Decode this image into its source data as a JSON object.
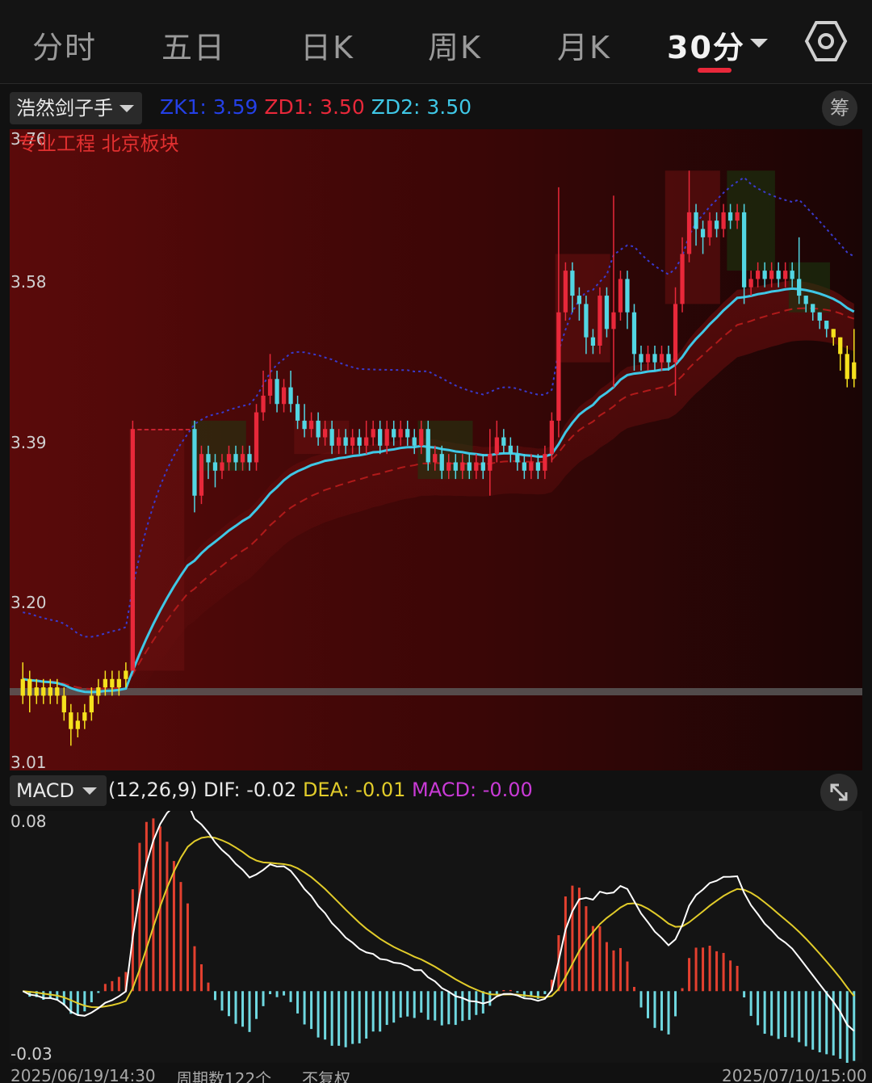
{
  "tabs": [
    {
      "label": "分时",
      "active": false
    },
    {
      "label": "五日",
      "active": false
    },
    {
      "label": "日K",
      "active": false
    },
    {
      "label": "周K",
      "active": false
    },
    {
      "label": "月K",
      "active": false
    },
    {
      "label": "30分",
      "active": true
    }
  ],
  "settings_icon": "hexagon-settings-icon",
  "indicator": {
    "name": "浩然剑子手",
    "zk1": "ZK1: 3.59",
    "zd1": "ZD1: 3.50",
    "zd2": "ZD2: 3.50",
    "chou_label": "筹"
  },
  "main_chart": {
    "price_labels": [
      "3.76",
      "3.58",
      "3.39",
      "3.20",
      "3.01"
    ],
    "sector_text": "专业工程 北京板块"
  },
  "macd": {
    "name": "MACD",
    "params": "(12,26,9)",
    "dif": "DIF: -0.02",
    "dea": "DEA: -0.01",
    "macd": "MACD: -0.00",
    "scale_top": "0.08",
    "scale_bottom": "-0.03"
  },
  "footer": {
    "start_time": "2025/06/19/14:30",
    "period_count": "周期数122个",
    "adjust": "不复权",
    "end_time": "2025/07/10/15:00"
  },
  "colors": {
    "up": "#e8283a",
    "down": "#52d6e3",
    "yellow": "#f5e11d",
    "zk1": "#2440e6",
    "zd1": "#e8283a",
    "zd2": "#3fc7e6",
    "dif": "#ffffff",
    "dea": "#e2cc2a",
    "macd": "#c93ad6",
    "hist_pos": "#e3402f",
    "hist_neg": "#6fd8e0"
  },
  "chart_data": {
    "type": "candlestick",
    "ylim": [
      3.01,
      3.76
    ],
    "candles": [
      [
        3.09,
        3.11,
        3.13,
        3.08
      ],
      [
        3.11,
        3.09,
        3.12,
        3.07
      ],
      [
        3.09,
        3.1,
        3.11,
        3.08
      ],
      [
        3.1,
        3.09,
        3.11,
        3.08
      ],
      [
        3.09,
        3.1,
        3.11,
        3.08
      ],
      [
        3.1,
        3.09,
        3.11,
        3.08
      ],
      [
        3.09,
        3.07,
        3.1,
        3.06
      ],
      [
        3.07,
        3.05,
        3.08,
        3.03
      ],
      [
        3.05,
        3.06,
        3.07,
        3.04
      ],
      [
        3.06,
        3.07,
        3.08,
        3.05
      ],
      [
        3.07,
        3.09,
        3.1,
        3.06
      ],
      [
        3.09,
        3.1,
        3.11,
        3.08
      ],
      [
        3.1,
        3.11,
        3.12,
        3.09
      ],
      [
        3.11,
        3.1,
        3.12,
        3.09
      ],
      [
        3.1,
        3.11,
        3.12,
        3.09
      ],
      [
        3.11,
        3.12,
        3.13,
        3.1
      ],
      [
        3.12,
        3.41,
        3.42,
        3.12
      ],
      [
        3.41,
        3.41,
        3.41,
        3.41
      ],
      [
        3.41,
        3.41,
        3.41,
        3.41
      ],
      [
        3.41,
        3.41,
        3.41,
        3.41
      ],
      [
        3.41,
        3.41,
        3.41,
        3.41
      ],
      [
        3.41,
        3.41,
        3.41,
        3.41
      ],
      [
        3.41,
        3.41,
        3.41,
        3.41
      ],
      [
        3.41,
        3.41,
        3.41,
        3.41
      ],
      [
        3.41,
        3.41,
        3.41,
        3.41
      ],
      [
        3.41,
        3.33,
        3.42,
        3.31
      ],
      [
        3.33,
        3.38,
        3.39,
        3.32
      ],
      [
        3.38,
        3.37,
        3.39,
        3.35
      ],
      [
        3.37,
        3.36,
        3.38,
        3.34
      ],
      [
        3.36,
        3.37,
        3.38,
        3.35
      ],
      [
        3.37,
        3.38,
        3.39,
        3.36
      ],
      [
        3.38,
        3.37,
        3.39,
        3.36
      ],
      [
        3.37,
        3.38,
        3.39,
        3.36
      ],
      [
        3.38,
        3.37,
        3.39,
        3.36
      ],
      [
        3.37,
        3.43,
        3.44,
        3.36
      ],
      [
        3.43,
        3.45,
        3.48,
        3.42
      ],
      [
        3.45,
        3.47,
        3.5,
        3.44
      ],
      [
        3.47,
        3.44,
        3.48,
        3.43
      ],
      [
        3.44,
        3.46,
        3.47,
        3.43
      ],
      [
        3.46,
        3.44,
        3.48,
        3.43
      ],
      [
        3.44,
        3.42,
        3.45,
        3.41
      ],
      [
        3.42,
        3.41,
        3.44,
        3.4
      ],
      [
        3.41,
        3.42,
        3.43,
        3.4
      ],
      [
        3.42,
        3.4,
        3.43,
        3.39
      ],
      [
        3.4,
        3.41,
        3.42,
        3.39
      ],
      [
        3.41,
        3.39,
        3.42,
        3.38
      ],
      [
        3.39,
        3.4,
        3.41,
        3.38
      ],
      [
        3.4,
        3.39,
        3.41,
        3.38
      ],
      [
        3.39,
        3.4,
        3.41,
        3.38
      ],
      [
        3.4,
        3.39,
        3.41,
        3.38
      ],
      [
        3.39,
        3.4,
        3.42,
        3.38
      ],
      [
        3.4,
        3.41,
        3.42,
        3.39
      ],
      [
        3.41,
        3.39,
        3.42,
        3.38
      ],
      [
        3.39,
        3.41,
        3.42,
        3.38
      ],
      [
        3.41,
        3.4,
        3.42,
        3.39
      ],
      [
        3.4,
        3.41,
        3.42,
        3.39
      ],
      [
        3.41,
        3.4,
        3.42,
        3.39
      ],
      [
        3.4,
        3.39,
        3.41,
        3.38
      ],
      [
        3.39,
        3.41,
        3.42,
        3.38
      ],
      [
        3.41,
        3.37,
        3.42,
        3.36
      ],
      [
        3.37,
        3.38,
        3.39,
        3.36
      ],
      [
        3.38,
        3.36,
        3.39,
        3.35
      ],
      [
        3.36,
        3.37,
        3.38,
        3.35
      ],
      [
        3.37,
        3.36,
        3.38,
        3.35
      ],
      [
        3.36,
        3.37,
        3.38,
        3.35
      ],
      [
        3.37,
        3.36,
        3.38,
        3.35
      ],
      [
        3.36,
        3.37,
        3.38,
        3.35
      ],
      [
        3.37,
        3.36,
        3.38,
        3.35
      ],
      [
        3.36,
        3.38,
        3.41,
        3.33
      ],
      [
        3.38,
        3.4,
        3.42,
        3.37
      ],
      [
        3.4,
        3.39,
        3.41,
        3.38
      ],
      [
        3.39,
        3.38,
        3.4,
        3.37
      ],
      [
        3.38,
        3.37,
        3.39,
        3.36
      ],
      [
        3.37,
        3.36,
        3.38,
        3.35
      ],
      [
        3.36,
        3.37,
        3.38,
        3.35
      ],
      [
        3.37,
        3.36,
        3.38,
        3.35
      ],
      [
        3.36,
        3.38,
        3.39,
        3.35
      ],
      [
        3.38,
        3.42,
        3.43,
        3.37
      ],
      [
        3.42,
        3.55,
        3.7,
        3.4
      ],
      [
        3.55,
        3.6,
        3.61,
        3.54
      ],
      [
        3.6,
        3.57,
        3.61,
        3.55
      ],
      [
        3.57,
        3.56,
        3.58,
        3.54
      ],
      [
        3.56,
        3.52,
        3.57,
        3.5
      ],
      [
        3.52,
        3.51,
        3.53,
        3.5
      ],
      [
        3.51,
        3.57,
        3.58,
        3.5
      ],
      [
        3.57,
        3.53,
        3.58,
        3.52
      ],
      [
        3.53,
        3.55,
        3.69,
        3.46
      ],
      [
        3.55,
        3.59,
        3.6,
        3.54
      ],
      [
        3.59,
        3.55,
        3.6,
        3.53
      ],
      [
        3.55,
        3.5,
        3.56,
        3.48
      ],
      [
        3.5,
        3.49,
        3.51,
        3.48
      ],
      [
        3.49,
        3.5,
        3.51,
        3.48
      ],
      [
        3.5,
        3.49,
        3.51,
        3.48
      ],
      [
        3.49,
        3.5,
        3.51,
        3.48
      ],
      [
        3.5,
        3.49,
        3.51,
        3.48
      ],
      [
        3.49,
        3.56,
        3.58,
        3.45
      ],
      [
        3.56,
        3.62,
        3.64,
        3.55
      ],
      [
        3.62,
        3.67,
        3.72,
        3.61
      ],
      [
        3.67,
        3.65,
        3.68,
        3.63
      ],
      [
        3.65,
        3.64,
        3.66,
        3.62
      ],
      [
        3.64,
        3.66,
        3.67,
        3.63
      ],
      [
        3.66,
        3.65,
        3.67,
        3.64
      ],
      [
        3.65,
        3.67,
        3.68,
        3.64
      ],
      [
        3.67,
        3.66,
        3.68,
        3.65
      ],
      [
        3.66,
        3.67,
        3.68,
        3.65
      ],
      [
        3.67,
        3.58,
        3.68,
        3.56
      ],
      [
        3.58,
        3.59,
        3.6,
        3.57
      ],
      [
        3.59,
        3.6,
        3.61,
        3.58
      ],
      [
        3.6,
        3.59,
        3.61,
        3.58
      ],
      [
        3.59,
        3.6,
        3.61,
        3.58
      ],
      [
        3.6,
        3.59,
        3.61,
        3.58
      ],
      [
        3.59,
        3.6,
        3.61,
        3.58
      ],
      [
        3.6,
        3.59,
        3.61,
        3.58
      ],
      [
        3.59,
        3.57,
        3.64,
        3.56
      ],
      [
        3.57,
        3.56,
        3.57,
        3.55
      ],
      [
        3.56,
        3.55,
        3.56,
        3.54
      ],
      [
        3.55,
        3.54,
        3.55,
        3.53
      ],
      [
        3.54,
        3.53,
        3.54,
        3.52
      ],
      [
        3.53,
        3.52,
        3.53,
        3.51
      ],
      [
        3.52,
        3.5,
        3.52,
        3.48
      ],
      [
        3.5,
        3.47,
        3.51,
        3.46
      ],
      [
        3.47,
        3.49,
        3.53,
        3.46
      ]
    ],
    "ma_slow_endpoints": [
      3.09,
      3.5
    ],
    "macd_range": [
      -0.03,
      0.08
    ]
  }
}
